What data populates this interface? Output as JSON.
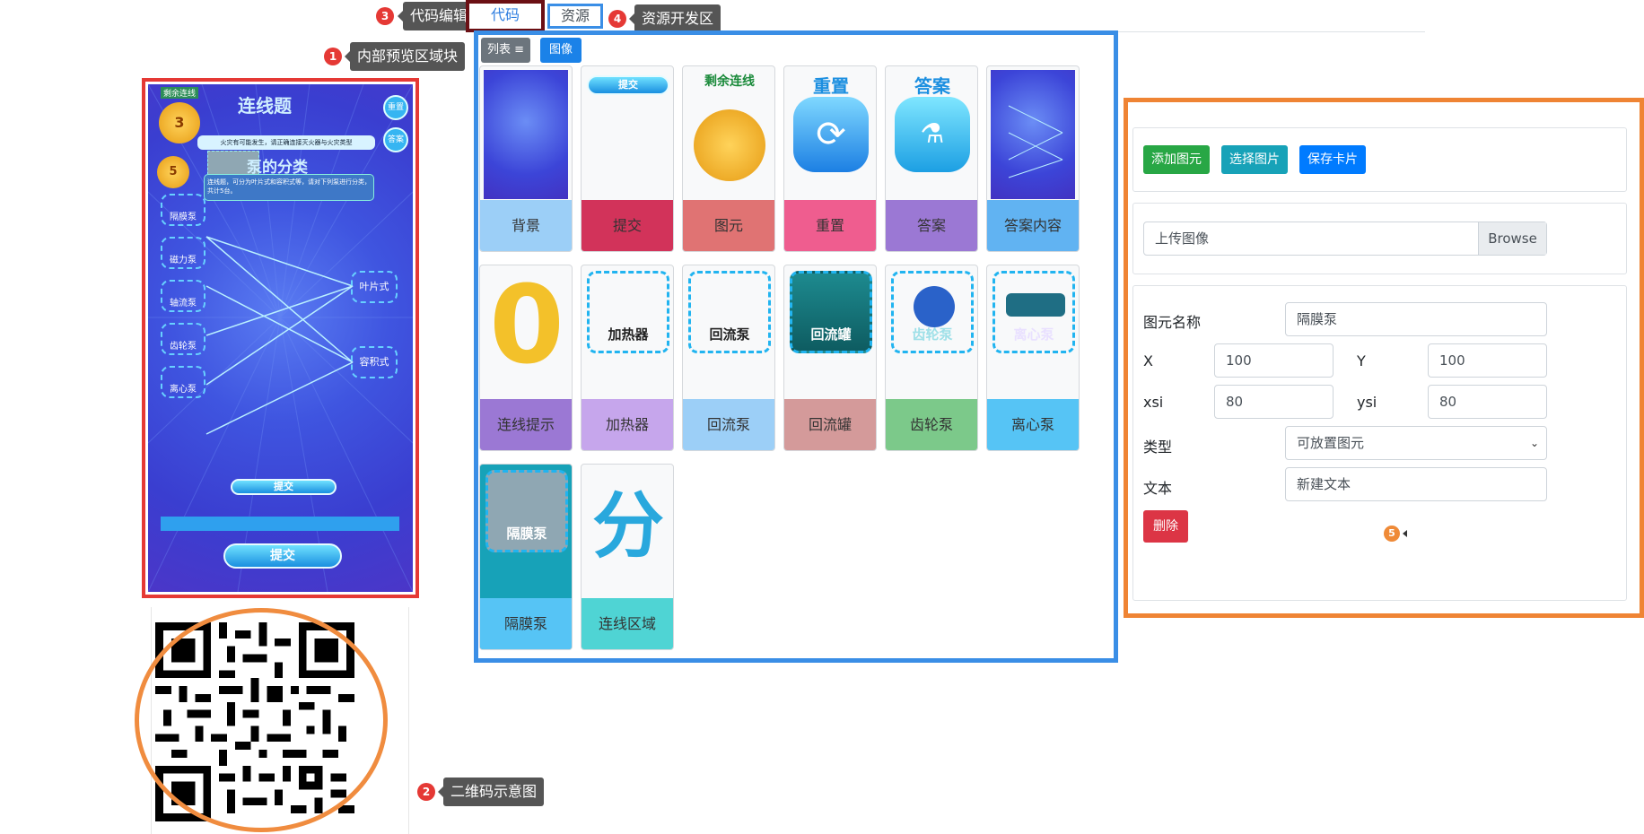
{
  "callouts": {
    "c1": {
      "num": "1",
      "text": "内部预览区域块"
    },
    "c2": {
      "num": "2",
      "text": "二维码示意图"
    },
    "c3": {
      "num": "3",
      "text": "代码编辑"
    },
    "c4": {
      "num": "4",
      "text": "资源开发区"
    },
    "c5": {
      "num": "5"
    }
  },
  "tabs": {
    "code": "代码",
    "resource": "资源"
  },
  "resource": {
    "list_label": "列表",
    "image_label": "图像",
    "cards": [
      {
        "label": "背景",
        "color": "#9ccff7"
      },
      {
        "label": "提交",
        "color": "#d2335a"
      },
      {
        "label": "图元",
        "color": "#e07373"
      },
      {
        "label": "重置",
        "color": "#ef5d8f"
      },
      {
        "label": "答案",
        "color": "#9b78d4"
      },
      {
        "label": "答案内容",
        "color": "#61b3f2"
      },
      {
        "label": "连线提示",
        "color": "#9b78d4"
      },
      {
        "label": "加热器",
        "color": "#c6a6ec"
      },
      {
        "label": "回流泵",
        "color": "#9ccff7"
      },
      {
        "label": "回流罐",
        "color": "#d49a9a"
      },
      {
        "label": "齿轮泵",
        "color": "#7cc98a"
      },
      {
        "label": "离心泵",
        "color": "#56c4f5"
      },
      {
        "label": "隔膜泵",
        "color": "#56c4f5"
      },
      {
        "label": "连线区域",
        "color": "#4fd4d4"
      }
    ],
    "thumb_text": {
      "submit": "提交",
      "remaining": "剩余连线",
      "reset": "重置",
      "answer": "答案",
      "zero": "0",
      "heater": "加热器",
      "reflux_pump": "回流泵",
      "reflux_tank": "回流罐",
      "gear_pump": "齿轮泵",
      "centrifugal": "离心泵",
      "diaphragm": "隔膜泵",
      "fen": "分"
    }
  },
  "preview": {
    "title": "连线题",
    "counter": "3",
    "counter2": "5",
    "remaining": "剩余连线",
    "tip_text": "火灾有可能发生，请正确连接灭火器与火灾类型",
    "subtitle": "泵的分类",
    "desc": "连线题，可分为叶片式和容积式等，请对下列泵进行分类，共计5台。",
    "reset_label": "重置",
    "answer_label": "答案",
    "left_items": [
      "隔膜泵",
      "磁力泵",
      "轴流泵",
      "齿轮泵",
      "离心泵"
    ],
    "right_items": [
      "叶片式",
      "容积式"
    ],
    "submit_small": "提交",
    "submit_big": "提交"
  },
  "editor": {
    "add_btn": "添加图元",
    "choose_btn": "选择图片",
    "save_btn": "保存卡片",
    "upload_placeholder": "上传图像",
    "browse": "Browse",
    "name_label": "图元名称",
    "name_value": "隔膜泵",
    "x_label": "X",
    "x_value": "100",
    "y_label": "Y",
    "y_value": "100",
    "xsi_label": "xsi",
    "xsi_value": "80",
    "ysi_label": "ysi",
    "ysi_value": "80",
    "type_label": "类型",
    "type_value": "可放置图元",
    "text_label": "文本",
    "text_value": "新建文本",
    "delete_btn": "删除"
  }
}
